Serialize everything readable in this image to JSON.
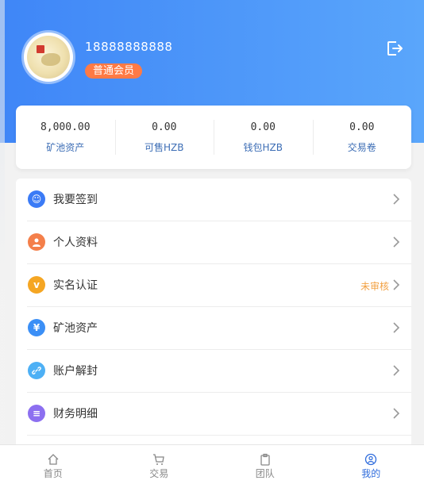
{
  "profile": {
    "phone": "18888888888",
    "member_level": "普通会员"
  },
  "stats": [
    {
      "value": "8,000.00",
      "label": "矿池资产"
    },
    {
      "value": "0.00",
      "label": "可售HZB"
    },
    {
      "value": "0.00",
      "label": "钱包HZB"
    },
    {
      "value": "0.00",
      "label": "交易卷"
    }
  ],
  "menu": [
    {
      "label": "我要签到",
      "icon": "sign-in-icon",
      "color": "#3b7bf6",
      "status": ""
    },
    {
      "label": "个人资料",
      "icon": "user-icon",
      "color": "#f47f4a",
      "status": ""
    },
    {
      "label": "实名认证",
      "icon": "verify-v-icon",
      "color": "#f5a623",
      "status": "未审核"
    },
    {
      "label": "矿池资产",
      "icon": "asset-icon",
      "color": "#3b8ff6",
      "status": ""
    },
    {
      "label": "账户解封",
      "icon": "link-icon",
      "color": "#4db0f5",
      "status": ""
    },
    {
      "label": "财务明细",
      "icon": "finance-icon",
      "color": "#8c6ff0",
      "status": ""
    }
  ],
  "tabs": [
    {
      "label": "首页",
      "icon": "home-icon"
    },
    {
      "label": "交易",
      "icon": "cart-icon"
    },
    {
      "label": "团队",
      "icon": "clipboard-icon"
    },
    {
      "label": "我的",
      "icon": "profile-icon"
    }
  ],
  "colors": {
    "header_start": "#3f86f7",
    "header_end": "#5aa6fb",
    "member_badge": "#ff7a45",
    "active_tab": "#2d6bdc",
    "status_pending": "#f2a143"
  }
}
